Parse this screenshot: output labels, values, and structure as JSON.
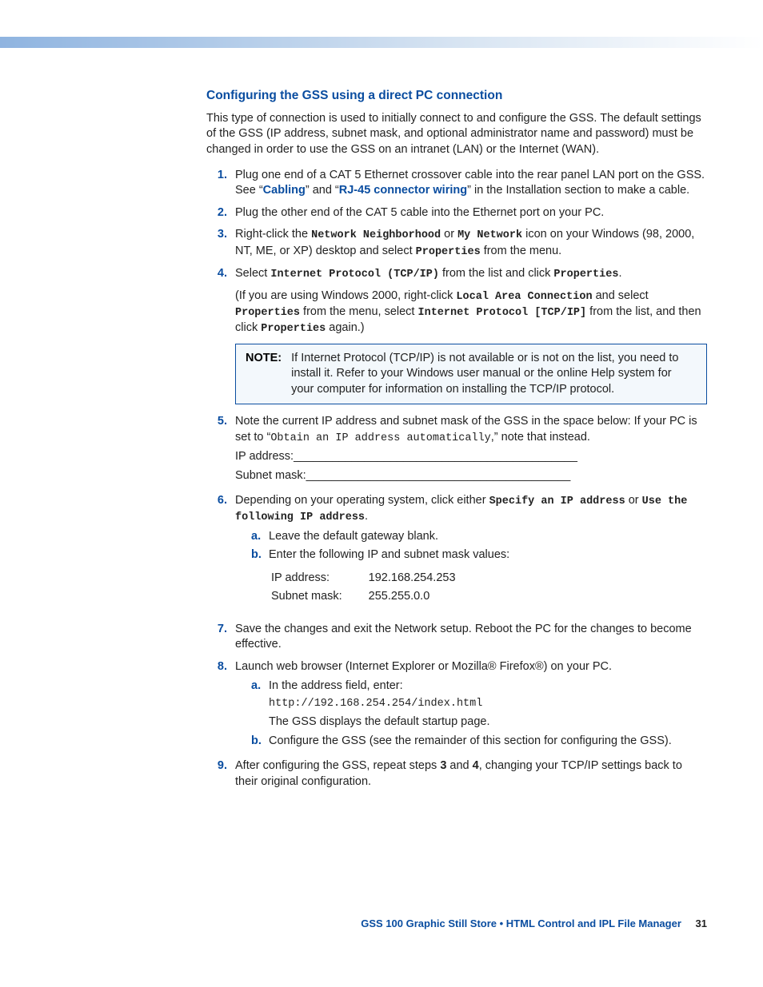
{
  "heading": "Configuring the GSS using a direct PC connection",
  "intro": "This type of connection is used to initially connect to and configure the GSS. The default settings of the GSS (IP address, subnet mask, and optional administrator name and password) must be changed in order to use the GSS on an intranet (LAN) or the Internet (WAN).",
  "step1_a": "Plug one end of a CAT 5 Ethernet crossover cable into the rear panel LAN port on the GSS. See “",
  "step1_link1": "Cabling",
  "step1_b": "” and “",
  "step1_link2": "RJ-45 connector wiring",
  "step1_c": "” in the Installation section to make a cable.",
  "step2": "Plug the other end of the CAT 5 cable into the Ethernet port on your PC.",
  "step3_a": "Right-click the ",
  "step3_m1": "Network Neighborhood",
  "step3_b": " or ",
  "step3_m2": "My Network",
  "step3_c": " icon on your Windows (98, 2000, NT, ME, or XP) desktop and select ",
  "step3_m3": "Properties",
  "step3_d": " from the menu.",
  "step4_a": "Select ",
  "step4_m1": "Internet Protocol (TCP/IP)",
  "step4_b": " from the list and click ",
  "step4_m2": "Properties",
  "step4_c": ".",
  "step4p_a": "(If you are using Windows 2000, right-click ",
  "step4p_m1": "Local Area Connection",
  "step4p_b": " and select ",
  "step4p_m2": "Properties",
  "step4p_c": " from the menu, select ",
  "step4p_m3": "Internet Protocol [TCP/IP]",
  "step4p_d": " from the list, and then click ",
  "step4p_m4": "Properties",
  "step4p_e": " again.)",
  "note_label": "NOTE:",
  "note_text": "If Internet Protocol (TCP/IP) is not available or is not on the list, you need to install it. Refer to your Windows user manual or the online Help system for your computer for information on installing the TCP/IP protocol.",
  "step5_a": "Note the current IP address and subnet mask of the GSS in the space below: If your PC is set to “",
  "step5_m1": "Obtain an IP address automatically",
  "step5_b": ",” note that instead.",
  "ip_blank": "IP address:____________________________________________",
  "subnet_blank": "Subnet mask:_________________________________________",
  "step6_a": "Depending on your operating system, click either ",
  "step6_m1": "Specify an IP address",
  "step6_b": " or ",
  "step6_m2": "Use the following IP address",
  "step6_c": ".",
  "s6a": "Leave the default gateway blank.",
  "s6b": "Enter the following IP and subnet mask values:",
  "ip_label": "IP address:",
  "ip_val": "192.168.254.253",
  "mask_label": "Subnet mask:",
  "mask_val": "255.255.0.0",
  "step7": "Save the changes and exit the Network setup. Reboot the PC for the changes to become effective.",
  "step8": "Launch web browser (Internet Explorer or Mozilla® Firefox®) on your PC.",
  "s8a": "In the address field, enter:",
  "s8a_url": "http://192.168.254.254/index.html",
  "s8a_2": "The GSS displays the default startup page.",
  "s8b": "Configure the GSS (see the remainder of this section for configuring the GSS).",
  "step9_a": "After configuring the GSS, repeat steps ",
  "step9_b3": "3",
  "step9_b": " and ",
  "step9_b4": "4",
  "step9_c": ", changing your TCP/IP settings back to their original configuration.",
  "footer": "GSS 100 Graphic Still Store • HTML Control and IPL File Manager",
  "page": "31"
}
